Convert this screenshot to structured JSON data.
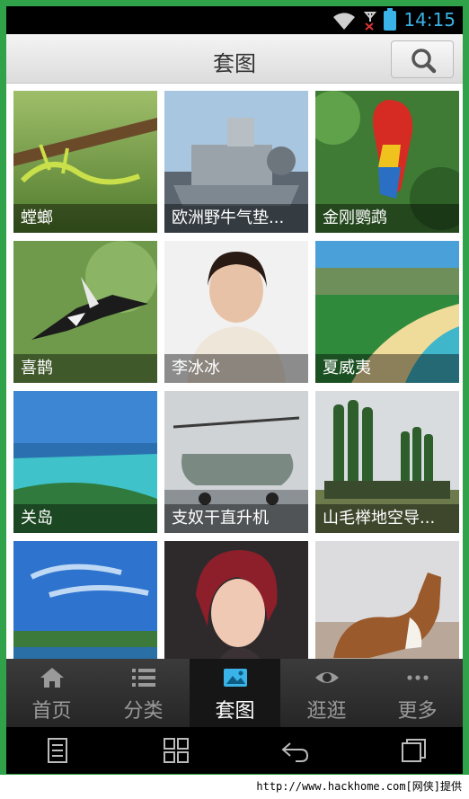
{
  "status_bar": {
    "time": "14:15"
  },
  "header": {
    "title": "套图"
  },
  "grid": {
    "items": [
      {
        "label": "螳螂"
      },
      {
        "label": "欧洲野牛气垫..."
      },
      {
        "label": "金刚鹦鹉"
      },
      {
        "label": "喜鹊"
      },
      {
        "label": "李冰冰"
      },
      {
        "label": "夏威夷"
      },
      {
        "label": "关岛"
      },
      {
        "label": "支奴干直升机"
      },
      {
        "label": "山毛榉地空导..."
      },
      {
        "label": ""
      },
      {
        "label": ""
      },
      {
        "label": ""
      }
    ]
  },
  "tabs": [
    {
      "label": "首页",
      "icon": "home-icon",
      "active": false
    },
    {
      "label": "分类",
      "icon": "list-icon",
      "active": false
    },
    {
      "label": "套图",
      "icon": "image-icon",
      "active": true
    },
    {
      "label": "逛逛",
      "icon": "eye-icon",
      "active": false
    },
    {
      "label": "更多",
      "icon": "more-icon",
      "active": false
    }
  ],
  "watermark": "http://www.hackhome.com[网侠]提供",
  "colors": {
    "accent": "#3ab3e8",
    "frame": "#2fa24a",
    "tabbar": "#2e2e2e"
  }
}
